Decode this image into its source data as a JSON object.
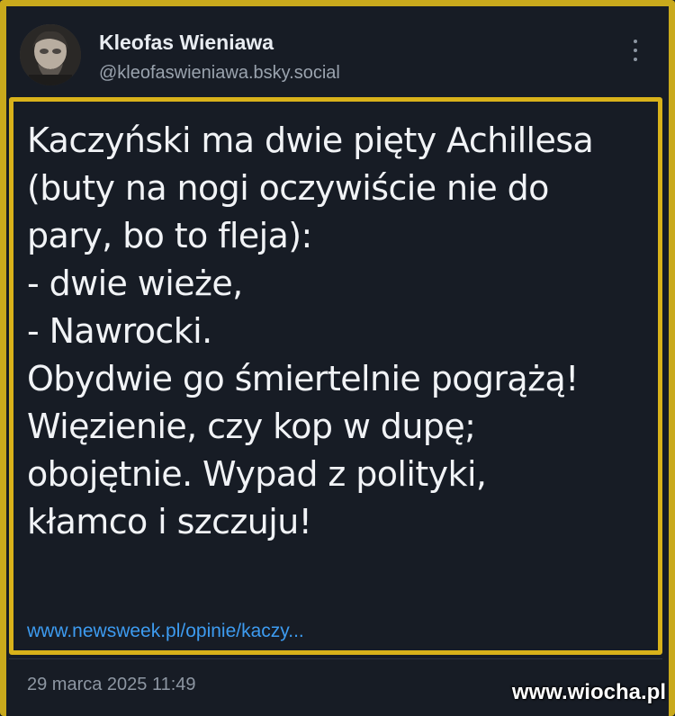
{
  "author": {
    "name": "Kleofas Wieniawa",
    "handle": "@kleofaswieniawa.bsky.social"
  },
  "post": {
    "lines": [
      "Kaczyński ma dwie pięty Achillesa",
      "(buty na nogi oczywiście nie do",
      "pary, bo to fleja):",
      "- dwie wieże,",
      "- Nawrocki.",
      "Obydwie go śmiertelnie pogrążą!",
      "Więzienie, czy kop w dupę;",
      "obojętnie. Wypad z polityki,",
      "kłamco i szczuju!"
    ],
    "link": "www.newsweek.pl/opinie/kaczy...",
    "timestamp": "29 marca 2025 11:49"
  },
  "icons": {
    "menu": "more-vertical-icon"
  },
  "watermark": "www.wiocha.pl",
  "colors": {
    "background": "#171c25",
    "frame": "#d9b21a",
    "link": "#3d9bf0",
    "text": "#f1f3f6"
  }
}
